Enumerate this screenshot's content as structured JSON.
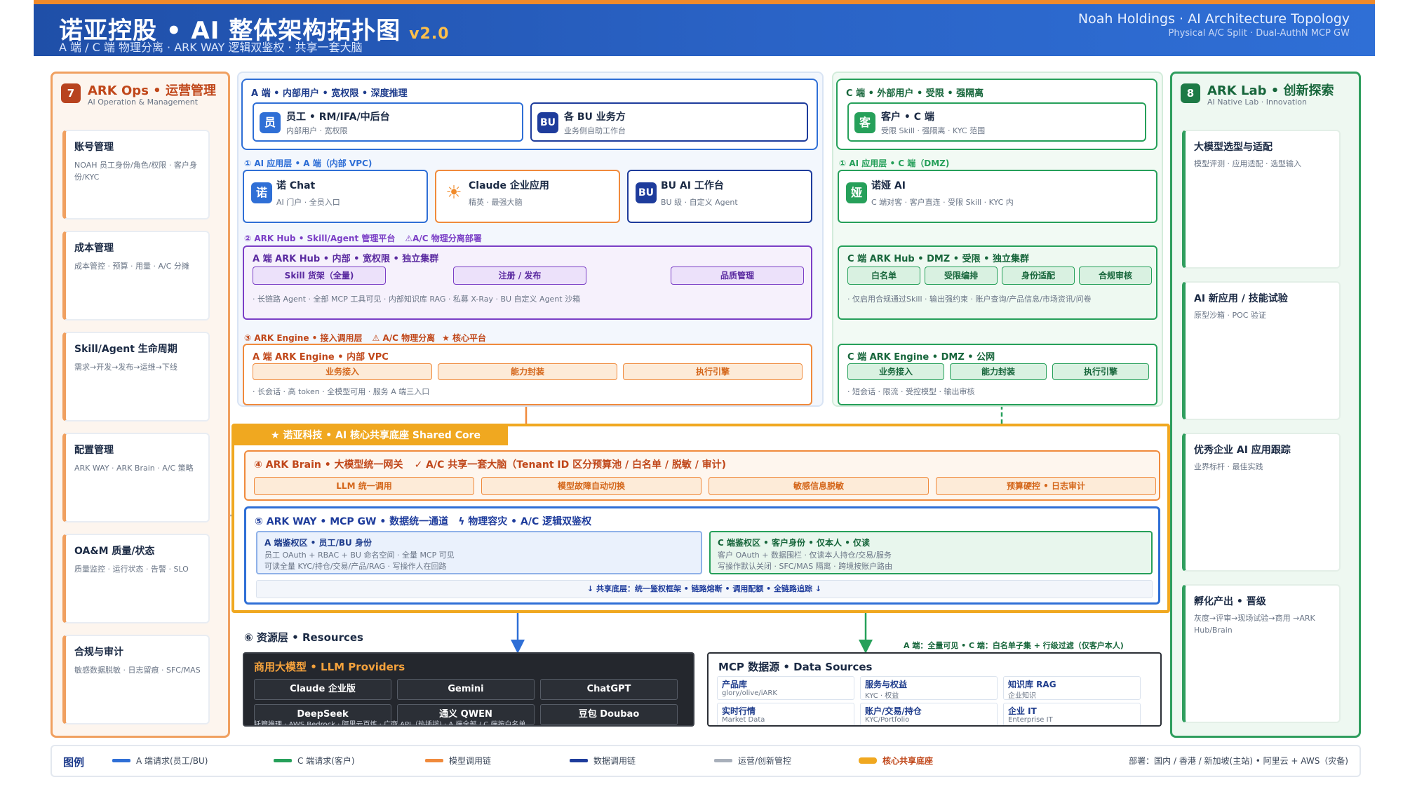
{
  "header": {
    "title": "诺亚控股 • AI 整体架构拓扑图",
    "version": "v2.0",
    "subtitle": "A 端 / C 端 物理分离 · ARK WAY 逻辑双鉴权 · 共享一套大脑",
    "right_title": "Noah Holdings · AI Architecture Topology",
    "right_sub": "Physical A/C Split · Dual-AuthN MCP GW"
  },
  "ops": {
    "badge": "7",
    "title": "ARK Ops • 运营管理",
    "sub": "AI Operation & Management",
    "items": [
      {
        "name": "账号管理",
        "desc": "NOAH 员工身份/角色/权限 · 客户身份/KYC"
      },
      {
        "name": "成本管理",
        "desc": "成本管控 · 预算 · 用量 · A/C 分摊"
      },
      {
        "name": "Skill/Agent 生命周期",
        "desc": "需求→开发→发布→运维→下线"
      },
      {
        "name": "配置管理",
        "desc": "ARK WAY · ARK Brain · A/C 策略"
      },
      {
        "name": "OA&M 质量/状态",
        "desc": "质量监控 · 运行状态 · 告警 · SLO"
      },
      {
        "name": "合规与审计",
        "desc": "敏感数据脱敏 · 日志留痕 · SFC/MAS"
      }
    ]
  },
  "lab": {
    "badge": "8",
    "title": "ARK Lab • 创新探索",
    "sub": "AI Native Lab · Innovation",
    "items": [
      {
        "name": "大模型选型与适配",
        "desc": "模型评测 · 应用适配 · 选型输入"
      },
      {
        "name": "AI 新应用 / 技能试验",
        "desc": "原型沙箱 · POC 验证"
      },
      {
        "name": "优秀企业 AI 应用跟踪",
        "desc": "业界标杆 · 最佳实践"
      },
      {
        "name": "孵化产出 • 晋级",
        "desc": "灰度→评审→现场试验→商用 →ARK Hub/Brain"
      }
    ]
  },
  "a_side": {
    "title": "A 端 • 内部用户 • 宽权限 • 深度推理",
    "user": {
      "icon": "员",
      "name": "员工 • RM/IFA/中后台",
      "desc": "内部用户 · 宽权限"
    },
    "bu": {
      "icon": "BU",
      "name": "各 BU 业务方",
      "desc": "业务侧自助工作台"
    },
    "app_label": "① AI 应用层 • A 端（内部 VPC)",
    "apps": [
      {
        "icon": "诺",
        "name": "诺 Chat",
        "desc": "AI 门户 · 全员入口"
      },
      {
        "icon": "☀",
        "name": "Claude 企业应用",
        "desc": "精英 · 最强大脑"
      },
      {
        "icon": "BU",
        "name": "BU AI 工作台",
        "desc": "BU 级 · 自定义 Agent"
      }
    ],
    "hub_label": "② ARK Hub • Skill/Agent 管理平台",
    "hub_warn": "A/C 物理分离部署",
    "hub_title": "A 端 ARK Hub • 内部 • 宽权限 • 独立集群",
    "hub_chips": [
      "Skill 货架（全量)",
      "注册 / 发布",
      "品质管理"
    ],
    "hub_desc": "· 长链路 Agent · 全部 MCP 工具可见 · 内部知识库 RAG · 私募 X-Ray · BU 自定义 Agent 沙箱",
    "engine_label": "③ ARK Engine • 接入调用层",
    "engine_warn": "A/C 物理分离",
    "engine_core": "核心平台",
    "engine_title": "A 端 ARK Engine • 内部 VPC",
    "engine_chips": [
      "业务接入",
      "能力封装",
      "执行引擎"
    ],
    "engine_desc": "· 长会话 · 高 token · 全模型可用 · 服务 A 端三入口"
  },
  "c_side": {
    "title": "C 端 • 外部用户 • 受限 • 强隔离",
    "user": {
      "icon": "客",
      "name": "客户 • C 端",
      "desc": "受限 Skill · 强隔离 · KYC 范围"
    },
    "app_label": "① AI 应用层 • C 端（DMZ)",
    "app": {
      "icon": "娅",
      "name": "诺娅 AI",
      "desc": "C 端对客 · 客户直连 · 受限 Skill · KYC 内"
    },
    "hub_title": "C 端 ARK Hub • DMZ • 受限 • 独立集群",
    "hub_chips": [
      "白名单",
      "受限编排",
      "身份适配",
      "合规审核"
    ],
    "hub_desc": "· 仅启用合规通过Skill · 输出强约束 · 账户查询/产品信息/市场资讯/问卷",
    "engine_title": "C 端 ARK Engine • DMZ • 公网",
    "engine_chips": [
      "业务接入",
      "能力封装",
      "执行引擎"
    ],
    "engine_desc": "· 短会话 · 限流 · 受控模型 · 输出审核"
  },
  "core": {
    "banner": "★ 诺亚科技 • AI 核心共享底座 Shared Core",
    "brain_title": "④ ARK Brain • 大模型统一网关",
    "brain_check": "✓ A/C 共享一套大脑（Tenant ID 区分预算池 / 白名单 / 脱敏 / 审计)",
    "brain_chips": [
      "LLM 统一调用",
      "模型故障自动切换",
      "敏感信息脱敏",
      "预算硬控 • 日志审计"
    ],
    "way_title": "⑤ ARK WAY • MCP GW • 数据统一通道",
    "way_note": "物理容灾 • A/C 逻辑双鉴权",
    "a_auth_title": "A 端鉴权区 • 员工/BU 身份",
    "a_auth_l1": "员工 OAuth + RBAC + BU 命名空间 · 全量 MCP 可见",
    "a_auth_l2": "可读全量 KYC/持仓/交易/产品/RAG · 写操作人在回路",
    "c_auth_title": "C 端鉴权区 • 客户身份 • 仅本人 • 仅读",
    "c_auth_l1": "客户 OAuth + 数据围栏 · 仅读本人持仓/交易/服务",
    "c_auth_l2": "写操作默认关闭 · SFC/MAS 隔离 · 跨境按账户路由",
    "shared": "↓ 共享底层：统一鉴权框架 • 链路熔断 • 调用配额 • 全链路追踪 ↓"
  },
  "resources": {
    "label": "⑥ 资源层 • Resources",
    "llm_title": "商用大模型 • LLM Providers",
    "llms": [
      "Claude 企业版",
      "Gemini",
      "ChatGPT",
      "DeepSeek",
      "通义 QWEN",
      "豆包 Doubao"
    ],
    "llm_note": "托管推理 · AWS Bedrock · 阿里云百炼 · 广商 API（热插拔) · A 端全部 / C 端按白名单",
    "ds_title": "MCP 数据源 • Data Sources",
    "ds": [
      {
        "name": "产品库",
        "desc": "glory/olive/iARK"
      },
      {
        "name": "服务与权益",
        "desc": "KYC · 权益"
      },
      {
        "name": "知识库 RAG",
        "desc": "企业知识"
      },
      {
        "name": "实时行情",
        "desc": "Market Data"
      },
      {
        "name": "账户/交易/持仓",
        "desc": "KYC/Portfolio"
      },
      {
        "name": "企业 IT",
        "desc": "Enterprise IT"
      }
    ],
    "ds_note": "A 端：全量可见 • C 端：白名单子集 + 行级过滤（仅客户本人)"
  },
  "legend": {
    "title": "图例",
    "items": [
      {
        "label": "A 端请求(员工/BU)",
        "color": "#2f6fd6"
      },
      {
        "label": "C 端请求(客户)",
        "color": "#26a05a"
      },
      {
        "label": "模型调用链",
        "color": "#f08a3c"
      },
      {
        "label": "数据调用链",
        "color": "#1e3c9c"
      },
      {
        "label": "运营/创新管控",
        "color": "#a9b0bb"
      },
      {
        "label": "核心共享底座",
        "color": "#f0a820"
      }
    ],
    "deploy": "部署：国内 / 香港 / 新加坡(主站) • 阿里云 + AWS（灾备)"
  },
  "colors": {
    "a_blue": "#2f6fd6",
    "c_green": "#26a05a",
    "orange": "#f08a3c",
    "purple": "#7b3fc6",
    "gold": "#f0a820",
    "dark": "#1e3c9c"
  }
}
